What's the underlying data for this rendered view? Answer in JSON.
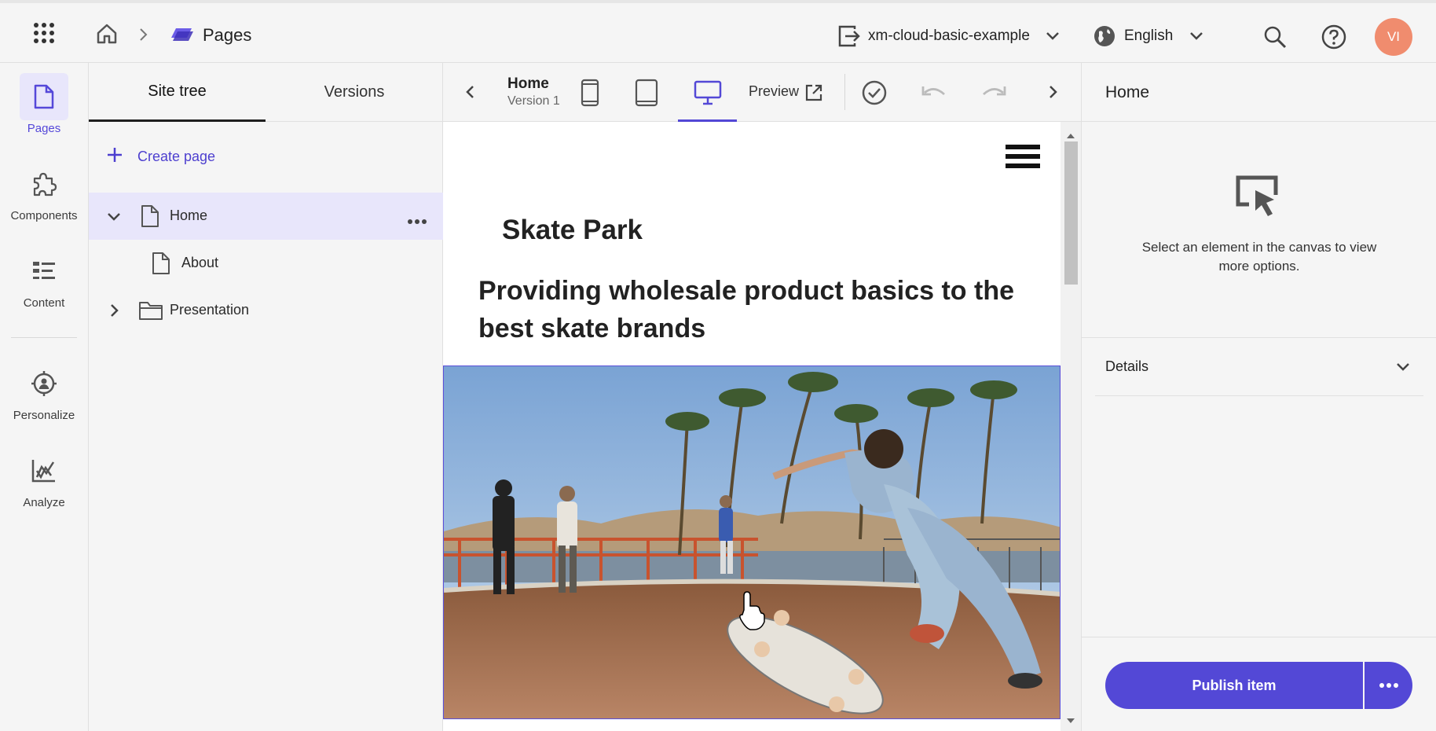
{
  "header": {
    "app_section": "Pages",
    "site_name": "xm-cloud-basic-example",
    "language": "English",
    "avatar_initials": "VI",
    "avatar_color": "#f08c6e",
    "accent": "#5348d6"
  },
  "leftnav": {
    "items": [
      {
        "label": "Pages",
        "icon": "page-icon"
      },
      {
        "label": "Components",
        "icon": "puzzle-icon"
      },
      {
        "label": "Content",
        "icon": "list-icon"
      },
      {
        "label": "Personalize",
        "icon": "target-icon"
      },
      {
        "label": "Analyze",
        "icon": "chart-icon"
      }
    ]
  },
  "tree": {
    "tabs": [
      "Site tree",
      "Versions"
    ],
    "create_label": "Create page",
    "items": [
      {
        "label": "Home"
      },
      {
        "label": "About"
      },
      {
        "label": "Presentation"
      }
    ]
  },
  "canvas_toolbar": {
    "page_title": "Home",
    "version": "Version 1",
    "preview_label": "Preview"
  },
  "canvas": {
    "site_title": "Skate Park",
    "headline": "Providing wholesale product basics to the best skate brands"
  },
  "rightpanel": {
    "title": "Home",
    "hint": "Select an element in the canvas to view more options.",
    "details_label": "Details",
    "publish_label": "Publish item"
  }
}
